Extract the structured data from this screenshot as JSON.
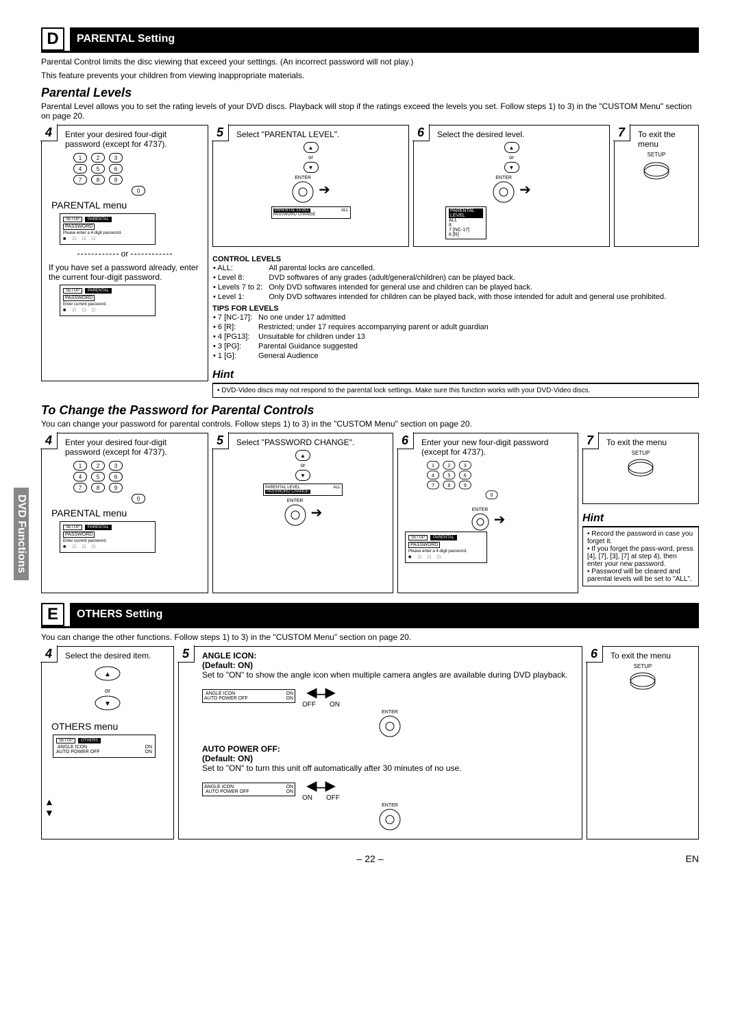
{
  "section_d": {
    "letter": "D",
    "title": "PARENTAL Setting",
    "intro1": "Parental Control limits the disc viewing that exceed your settings. (An incorrect password will not play.)",
    "intro2": "This feature prevents your children from viewing inappropriate materials."
  },
  "parental_levels": {
    "title": "Parental Levels",
    "desc": "Parental Level allows you to set the rating levels of your DVD discs. Playback will stop if the ratings exceed the levels you set. Follow steps 1) to 3) in the \"CUSTOM Menu\" section on page 20.",
    "step4": "Enter your desired four-digit password (except for 4737).",
    "parental_menu": "PARENTAL menu",
    "menu1_btn_setup": "SETUP",
    "menu1_btn_parental": "PARENTAL",
    "menu1_msg": "Please enter a 4-digit password.",
    "menu1_password": "PASSWORD",
    "or_text": "or",
    "or_desc": "If you have set a password already, enter the current four-digit password.",
    "menu2_msg": "Enter current password.",
    "step5": "Select \"PARENTAL LEVEL\".",
    "enter_label": "ENTER",
    "mini_pl": "PARENTAL LEVEL",
    "mini_pc": "PASSWORD CHANGE",
    "mini_all": "ALL",
    "step6": "Select the desired level.",
    "levels": [
      "8",
      "7 [NC-17]",
      "6 [R]"
    ],
    "step7": "To exit the menu",
    "setup_label": "SETUP",
    "control_levels": {
      "title": "CONTROL LEVELS",
      "rows": [
        [
          "• ALL:",
          "All parental locks are cancelled."
        ],
        [
          "• Level 8:",
          "DVD softwares of any grades (adult/general/children) can be played back."
        ],
        [
          "• Levels 7 to 2:",
          "Only DVD softwares intended for general use and children can be played back."
        ],
        [
          "• Level 1:",
          "Only DVD softwares intended for children can be played back, with those intended for adult and general use prohibited."
        ]
      ]
    },
    "tips": {
      "title": "TIPS FOR LEVELS",
      "rows": [
        [
          "• 7 [NC-17]:",
          "No one under 17 admitted"
        ],
        [
          "• 6 [R]:",
          "Restricted; under 17 requires accompanying parent or adult guardian"
        ],
        [
          "• 4 [PG13]:",
          "Unsuitable for children under 13"
        ],
        [
          "• 3 [PG]:",
          "Parental Guidance suggested"
        ],
        [
          "• 1 [G]:",
          "General Audience"
        ]
      ]
    },
    "hint": {
      "title": "Hint",
      "body": "• DVD-Video discs may not respond to the parental lock settings. Make sure this function works with your DVD-Video discs."
    }
  },
  "change_pwd": {
    "title": "To Change the Password for Parental Controls",
    "desc": "You can change your password for parental controls.  Follow steps 1) to 3) in the \"CUSTOM Menu\" section on page 20.",
    "step4": "Enter your desired four-digit password (except for 4737).",
    "parental_menu": "PARENTAL menu",
    "menu_msg": "Enter current password.",
    "step5": "Select \"PASSWORD CHANGE\".",
    "step6": "Enter your new four-digit password (except for 4737).",
    "menu6_msg": "Please enter a 4-digit password.",
    "step7": "To exit the menu",
    "hint": {
      "title": "Hint",
      "b1": "• Record the password in case you forget it.",
      "b2": "• If you forget the pass-word, press [4], [7], [3], [7] at step 4), then enter your new password.",
      "b3": "• Password will be cleared and parental levels will be set to \"ALL\"."
    }
  },
  "side_tab": "DVD Functions",
  "section_e": {
    "letter": "E",
    "title": "OTHERS Setting",
    "intro": "You can change the other functions. Follow steps 1) to 3) in the \"CUSTOM Menu\" section on page 20.",
    "step4": "Select the desired item.",
    "others_menu": "OTHERS menu",
    "menu_setup": "SETUP",
    "menu_others": "OTHERS",
    "menu_angle": "ANGLE ICON",
    "menu_auto": "AUTO POWER OFF",
    "menu_on": "ON",
    "angle": {
      "title": "ANGLE ICON:",
      "default": "(Default: ON)",
      "desc": "Set to \"ON\" to show the angle icon when multiple camera angles are available during DVD playback.",
      "opt_off": "OFF",
      "opt_on": "ON"
    },
    "auto": {
      "title": "AUTO POWER OFF:",
      "default": "(Default: ON)",
      "desc": "Set to \"ON\" to turn this unit off automatically after 30 minutes of no use.",
      "opt_off": "OFF",
      "opt_on": "ON"
    },
    "step6": "To exit the menu"
  },
  "footer": {
    "page": "– 22 –",
    "en": "EN"
  }
}
